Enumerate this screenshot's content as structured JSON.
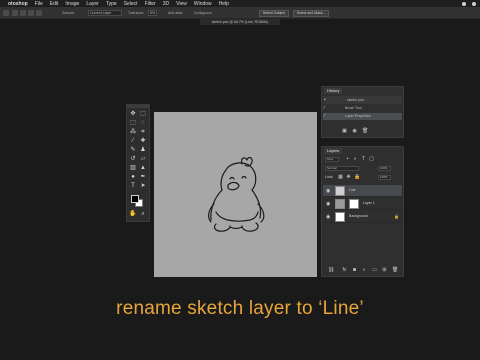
{
  "menubar": {
    "app_name": "otoshop",
    "items": [
      "File",
      "Edit",
      "Image",
      "Layer",
      "Type",
      "Select",
      "Filter",
      "3D",
      "View",
      "Window",
      "Help"
    ]
  },
  "options_bar": {
    "sample_label": "Sample:",
    "sample_value": "Current Layer",
    "tolerance_label": "Tolerance:",
    "tolerance_value": "5%",
    "anti_alias": "Anti-alias",
    "contiguous": "Contiguous",
    "select_subject": "Select Subject",
    "select_and_mask": "Select and Mask..."
  },
  "document_tab": {
    "title": "sketch.psd @ 66.7% (Line, RGB/8#)"
  },
  "history_panel": {
    "tab_label": "History",
    "rows": [
      "sketch.psd",
      "Brush Tool",
      "Layer Properties"
    ]
  },
  "layers_panel": {
    "tab_label": "Layers",
    "kind_label": "Kind",
    "blend_mode": "Normal",
    "opacity": "100%",
    "lock_label": "Lock:",
    "fill": "100%",
    "layers": [
      {
        "name": "Line",
        "type": "sketch"
      },
      {
        "name": "Layer 1",
        "type": "masked"
      },
      {
        "name": "Background",
        "type": "background"
      }
    ]
  },
  "caption": {
    "text": "rename sketch layer to ‘Line’"
  },
  "icons": {
    "apple": "apple-icon",
    "eye": "eye-icon",
    "lock": "lock-icon",
    "brush": "brush-icon"
  },
  "colors": {
    "caption": "#e7a53a",
    "canvas": "#a7a7a7",
    "app_bg": "#1a1a1a",
    "selected_layer": "#46494d"
  }
}
